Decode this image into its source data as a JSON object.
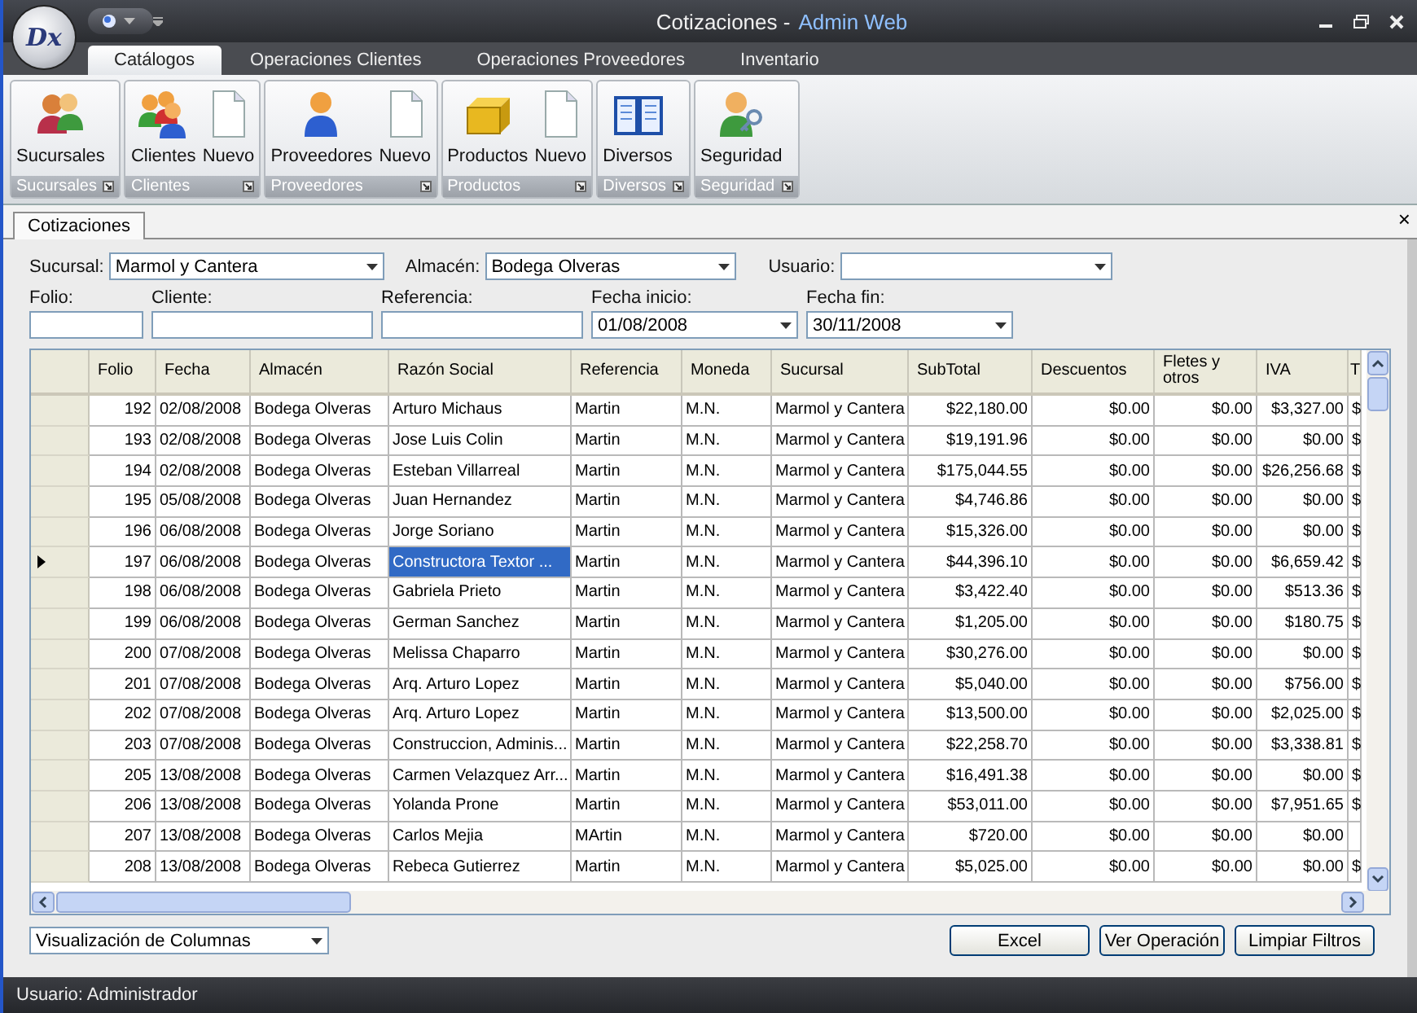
{
  "window": {
    "logo": "Dx",
    "title": "Cotizaciones -",
    "app": "Admin Web"
  },
  "ribbon_tabs": [
    {
      "label": "Catálogos",
      "selected": true
    },
    {
      "label": "Operaciones Clientes",
      "selected": false
    },
    {
      "label": "Operaciones Proveedores",
      "selected": false
    },
    {
      "label": "Inventario",
      "selected": false
    }
  ],
  "ribbon_groups": [
    {
      "label": "Sucursales",
      "buttons": [
        {
          "label": "Sucursales",
          "kind": "people"
        }
      ]
    },
    {
      "label": "Clientes",
      "buttons": [
        {
          "label": "Clientes",
          "kind": "group"
        },
        {
          "label": "Nuevo",
          "kind": "document"
        }
      ]
    },
    {
      "label": "Proveedores",
      "buttons": [
        {
          "label": "Proveedores",
          "kind": "person"
        },
        {
          "label": "Nuevo",
          "kind": "document"
        }
      ]
    },
    {
      "label": "Productos",
      "buttons": [
        {
          "label": "Productos",
          "kind": "box"
        },
        {
          "label": "Nuevo",
          "kind": "document"
        }
      ]
    },
    {
      "label": "Diversos",
      "buttons": [
        {
          "label": "Diversos",
          "kind": "book"
        }
      ]
    },
    {
      "label": "Seguridad",
      "buttons": [
        {
          "label": "Seguridad",
          "kind": "key-person"
        }
      ]
    }
  ],
  "document_tabs": [
    {
      "label": "Cotizaciones",
      "selected": true
    }
  ],
  "document_close": "×",
  "filters": {
    "sucursal": {
      "label": "Sucursal:",
      "value": "Marmol y Cantera"
    },
    "almacen": {
      "label": "Almacén:",
      "value": "Bodega Olveras"
    },
    "usuario": {
      "label": "Usuario:"
    },
    "folio": {
      "label": "Folio:"
    },
    "cliente": {
      "label": "Cliente:"
    },
    "referencia": {
      "label": "Referencia:"
    },
    "fecha_inicio": {
      "label": "Fecha inicio:",
      "value": "01/08/2008"
    },
    "fecha_fin": {
      "label": "Fecha fin:",
      "value": "30/11/2008"
    }
  },
  "table": {
    "columns": [
      {
        "label": "Folio",
        "kind": "number",
        "focused": false
      },
      {
        "label": "Fecha",
        "kind": "text",
        "focused": false
      },
      {
        "label": "Almacén",
        "kind": "text",
        "focused": false
      },
      {
        "label": "Razón Social",
        "kind": "text",
        "focused": true
      },
      {
        "label": "Referencia",
        "kind": "text",
        "focused": false
      },
      {
        "label": "Moneda",
        "kind": "text",
        "focused": false
      },
      {
        "label": "Sucursal",
        "kind": "text",
        "focused": false
      },
      {
        "label": "SubTotal",
        "kind": "number",
        "focused": false
      },
      {
        "label": "Descuentos",
        "kind": "number",
        "focused": false
      },
      {
        "label": "Fletes y otros",
        "kind": "number",
        "focused": false
      },
      {
        "label": "IVA",
        "kind": "number",
        "focused": false
      },
      {
        "label": "T",
        "kind": "text",
        "focused": false
      }
    ],
    "rows": [
      {
        "selected": false,
        "cells": [
          "192",
          "02/08/2008",
          "Bodega Olveras",
          "Arturo Michaus",
          "Martin",
          "M.N.",
          "Marmol y Cantera",
          "$22,180.00",
          "$0.00",
          "$0.00",
          "$3,327.00",
          "$"
        ]
      },
      {
        "selected": false,
        "cells": [
          "193",
          "02/08/2008",
          "Bodega Olveras",
          "Jose Luis Colin",
          "Martin",
          "M.N.",
          "Marmol y Cantera",
          "$19,191.96",
          "$0.00",
          "$0.00",
          "$0.00",
          "$"
        ]
      },
      {
        "selected": false,
        "cells": [
          "194",
          "02/08/2008",
          "Bodega Olveras",
          "Esteban Villarreal",
          "Martin",
          "M.N.",
          "Marmol y Cantera",
          "$175,044.55",
          "$0.00",
          "$0.00",
          "$26,256.68",
          "$"
        ]
      },
      {
        "selected": false,
        "cells": [
          "195",
          "05/08/2008",
          "Bodega Olveras",
          "Juan Hernandez",
          "Martin",
          "M.N.",
          "Marmol y Cantera",
          "$4,746.86",
          "$0.00",
          "$0.00",
          "$0.00",
          "$"
        ]
      },
      {
        "selected": false,
        "cells": [
          "196",
          "06/08/2008",
          "Bodega Olveras",
          "Jorge Soriano",
          "Martin",
          "M.N.",
          "Marmol y Cantera",
          "$15,326.00",
          "$0.00",
          "$0.00",
          "$0.00",
          "$"
        ]
      },
      {
        "selected": true,
        "cells": [
          "197",
          "06/08/2008",
          "Bodega Olveras",
          "Constructora Textor ...",
          "Martin",
          "M.N.",
          "Marmol y Cantera",
          "$44,396.10",
          "$0.00",
          "$0.00",
          "$6,659.42",
          "$"
        ]
      },
      {
        "selected": false,
        "cells": [
          "198",
          "06/08/2008",
          "Bodega Olveras",
          "Gabriela Prieto",
          "Martin",
          "M.N.",
          "Marmol y Cantera",
          "$3,422.40",
          "$0.00",
          "$0.00",
          "$513.36",
          "$"
        ]
      },
      {
        "selected": false,
        "cells": [
          "199",
          "06/08/2008",
          "Bodega Olveras",
          "German Sanchez",
          "Martin",
          "M.N.",
          "Marmol y Cantera",
          "$1,205.00",
          "$0.00",
          "$0.00",
          "$180.75",
          "$"
        ]
      },
      {
        "selected": false,
        "cells": [
          "200",
          "07/08/2008",
          "Bodega Olveras",
          "Melissa Chaparro",
          "Martin",
          "M.N.",
          "Marmol y Cantera",
          "$30,276.00",
          "$0.00",
          "$0.00",
          "$0.00",
          "$"
        ]
      },
      {
        "selected": false,
        "cells": [
          "201",
          "07/08/2008",
          "Bodega Olveras",
          "Arq. Arturo Lopez",
          "Martin",
          "M.N.",
          "Marmol y Cantera",
          "$5,040.00",
          "$0.00",
          "$0.00",
          "$756.00",
          "$"
        ]
      },
      {
        "selected": false,
        "cells": [
          "202",
          "07/08/2008",
          "Bodega Olveras",
          "Arq. Arturo Lopez",
          "Martin",
          "M.N.",
          "Marmol y Cantera",
          "$13,500.00",
          "$0.00",
          "$0.00",
          "$2,025.00",
          "$"
        ]
      },
      {
        "selected": false,
        "cells": [
          "203",
          "07/08/2008",
          "Bodega Olveras",
          "Construccion, Adminis...",
          "Martin",
          "M.N.",
          "Marmol y Cantera",
          "$22,258.70",
          "$0.00",
          "$0.00",
          "$3,338.81",
          "$"
        ]
      },
      {
        "selected": false,
        "cells": [
          "205",
          "13/08/2008",
          "Bodega Olveras",
          "Carmen Velazquez Arr...",
          "Martin",
          "M.N.",
          "Marmol y Cantera",
          "$16,491.38",
          "$0.00",
          "$0.00",
          "$0.00",
          "$"
        ]
      },
      {
        "selected": false,
        "cells": [
          "206",
          "13/08/2008",
          "Bodega Olveras",
          "Yolanda Prone",
          "Martin",
          "M.N.",
          "Marmol y Cantera",
          "$53,011.00",
          "$0.00",
          "$0.00",
          "$7,951.65",
          "$"
        ]
      },
      {
        "selected": false,
        "cells": [
          "207",
          "13/08/2008",
          "Bodega Olveras",
          "Carlos Mejia",
          "MArtin",
          "M.N.",
          "Marmol y Cantera",
          "$720.00",
          "$0.00",
          "$0.00",
          "$0.00"
        ]
      },
      {
        "selected": false,
        "cells": [
          "208",
          "13/08/2008",
          "Bodega Olveras",
          "Rebeca Gutierrez",
          "Martin",
          "M.N.",
          "Marmol y Cantera",
          "$5,025.00",
          "$0.00",
          "$0.00",
          "$0.00",
          "$"
        ]
      }
    ]
  },
  "column_view": {
    "value": "Visualización de Columnas"
  },
  "buttons": [
    "Excel",
    "Ver Operación",
    "Limpiar Filtros"
  ],
  "status_bar": "Usuario: Administrador"
}
